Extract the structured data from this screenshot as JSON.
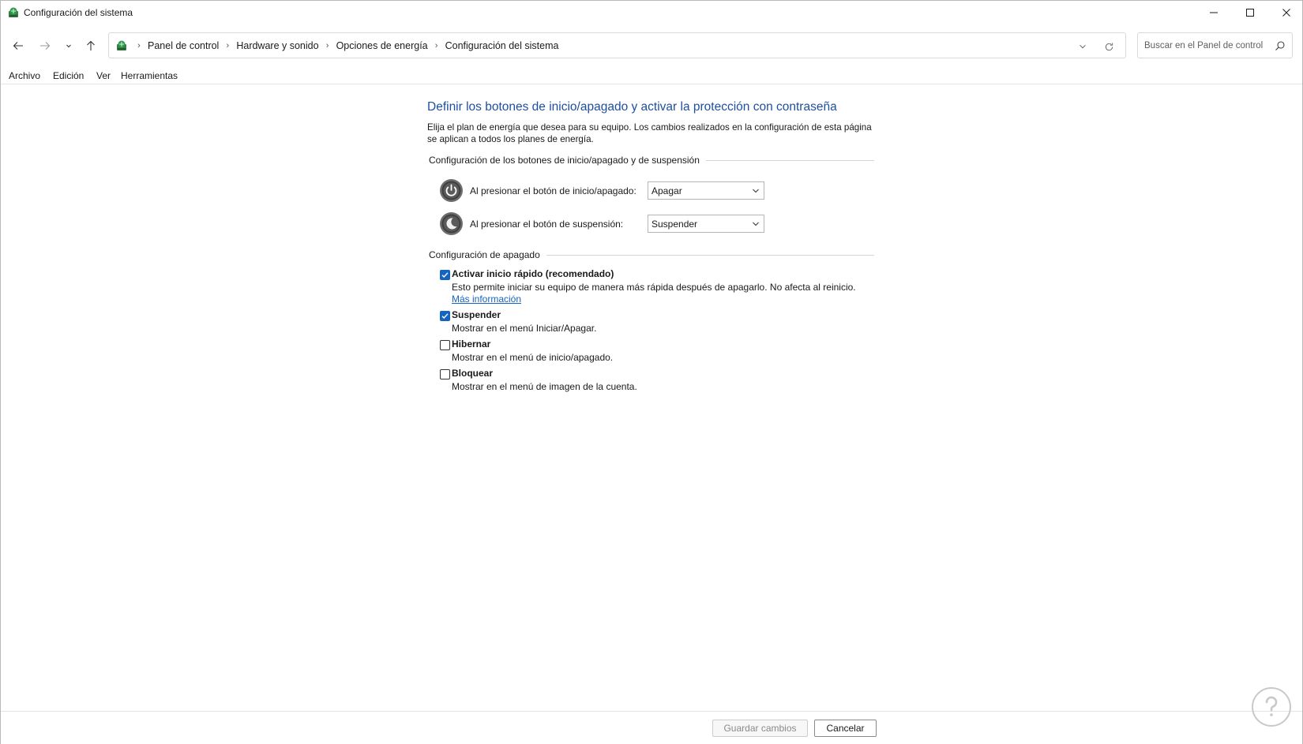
{
  "window": {
    "title": "Configuración del sistema"
  },
  "nav": {
    "breadcrumbs": [
      "Panel de control",
      "Hardware y sonido",
      "Opciones de energía",
      "Configuración del sistema"
    ],
    "search_placeholder": "Buscar en el Panel de control"
  },
  "menu": {
    "items": [
      "Archivo",
      "Edición",
      "Ver",
      "Herramientas"
    ]
  },
  "main": {
    "heading": "Definir los botones de inicio/apagado y activar la protección con contraseña",
    "description": "Elija el plan de energía que desea para su equipo. Los cambios realizados en la configuración de esta página se aplican a todos los planes de energía.",
    "power_section": {
      "title": "Configuración de los botones de inicio/apagado y de suspensión",
      "rows": [
        {
          "label": "Al presionar el botón de inicio/apagado:",
          "value": "Apagar",
          "icon": "power-icon"
        },
        {
          "label": "Al presionar el botón de suspensión:",
          "value": "Suspender",
          "icon": "sleep-icon"
        }
      ]
    },
    "shutdown_section": {
      "title": "Configuración de apagado",
      "options": [
        {
          "title": "Activar inicio rápido (recomendado)",
          "checked": true,
          "desc": "Esto permite iniciar su equipo de manera más rápida después de apagarlo. No afecta al reinicio.",
          "link": "Más información"
        },
        {
          "title": "Suspender",
          "checked": true,
          "desc": "Mostrar en el menú Iniciar/Apagar."
        },
        {
          "title": "Hibernar",
          "checked": false,
          "desc": "Mostrar en el menú de inicio/apagado."
        },
        {
          "title": "Bloquear",
          "checked": false,
          "desc": "Mostrar en el menú de imagen de la cuenta."
        }
      ]
    }
  },
  "footer": {
    "save_label": "Guardar cambios",
    "cancel_label": "Cancelar"
  },
  "colors": {
    "heading": "#1e4fa0",
    "link": "#1565c0",
    "checkbox_checked": "#1565c0"
  }
}
